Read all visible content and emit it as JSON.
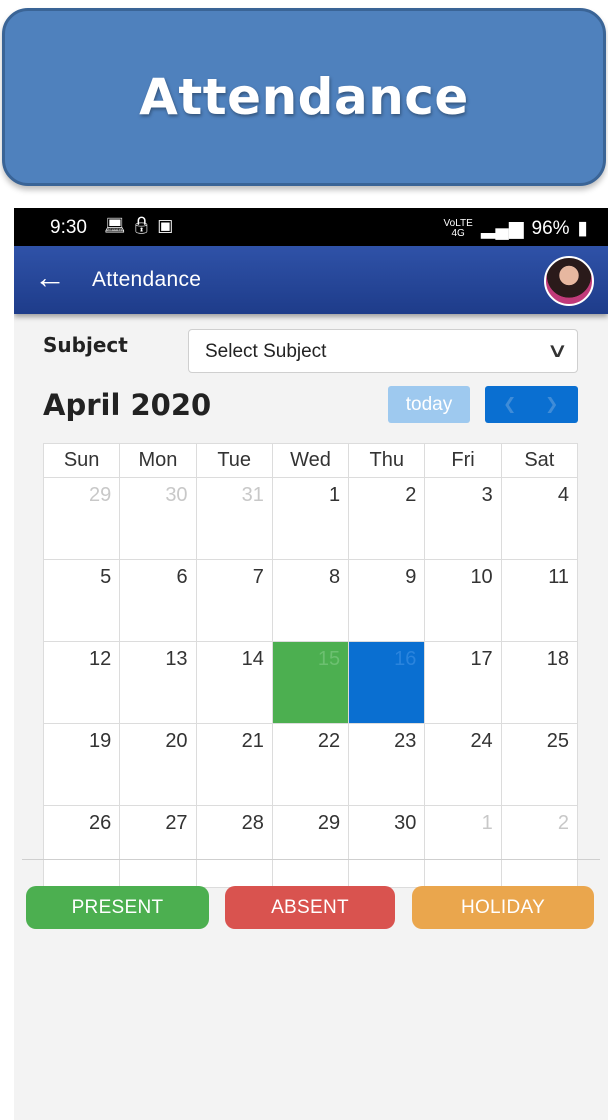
{
  "banner": {
    "title": "Attendance"
  },
  "status_bar": {
    "time": "9:30",
    "left_icons": [
      "laptop-icon",
      "lock-icon",
      "wifi-icon"
    ],
    "network": "4G",
    "network_sub": "VoLTE",
    "battery": "96%"
  },
  "app_bar": {
    "title": "Attendance",
    "back_icon": "arrow-left-icon",
    "avatar": "user-avatar"
  },
  "subject": {
    "label": "Subject",
    "selected_value": "Select Subject"
  },
  "calendar": {
    "month_title": "April 2020",
    "today_label": "today",
    "prev_icon": "chevron-left-icon",
    "next_icon": "chevron-right-icon",
    "weekdays": [
      "Sun",
      "Mon",
      "Tue",
      "Wed",
      "Thu",
      "Fri",
      "Sat"
    ],
    "weeks": [
      [
        "29",
        "30",
        "31",
        "1",
        "2",
        "3",
        "4"
      ],
      [
        "5",
        "6",
        "7",
        "8",
        "9",
        "10",
        "11"
      ],
      [
        "12",
        "13",
        "14",
        "15",
        "16",
        "17",
        "18"
      ],
      [
        "19",
        "20",
        "21",
        "22",
        "23",
        "24",
        "25"
      ],
      [
        "26",
        "27",
        "28",
        "29",
        "30",
        "1",
        "2"
      ]
    ],
    "present_day": "15",
    "selected_day": "16",
    "colors": {
      "present": "#4caf50",
      "selected": "#0a6fd1"
    }
  },
  "legend": {
    "present_label": "PRESENT",
    "absent_label": "ABSENT",
    "holiday_label": "HOLIDAY",
    "colors": {
      "present": "#4caf50",
      "absent": "#d9534f",
      "holiday": "#eaa64d"
    }
  }
}
